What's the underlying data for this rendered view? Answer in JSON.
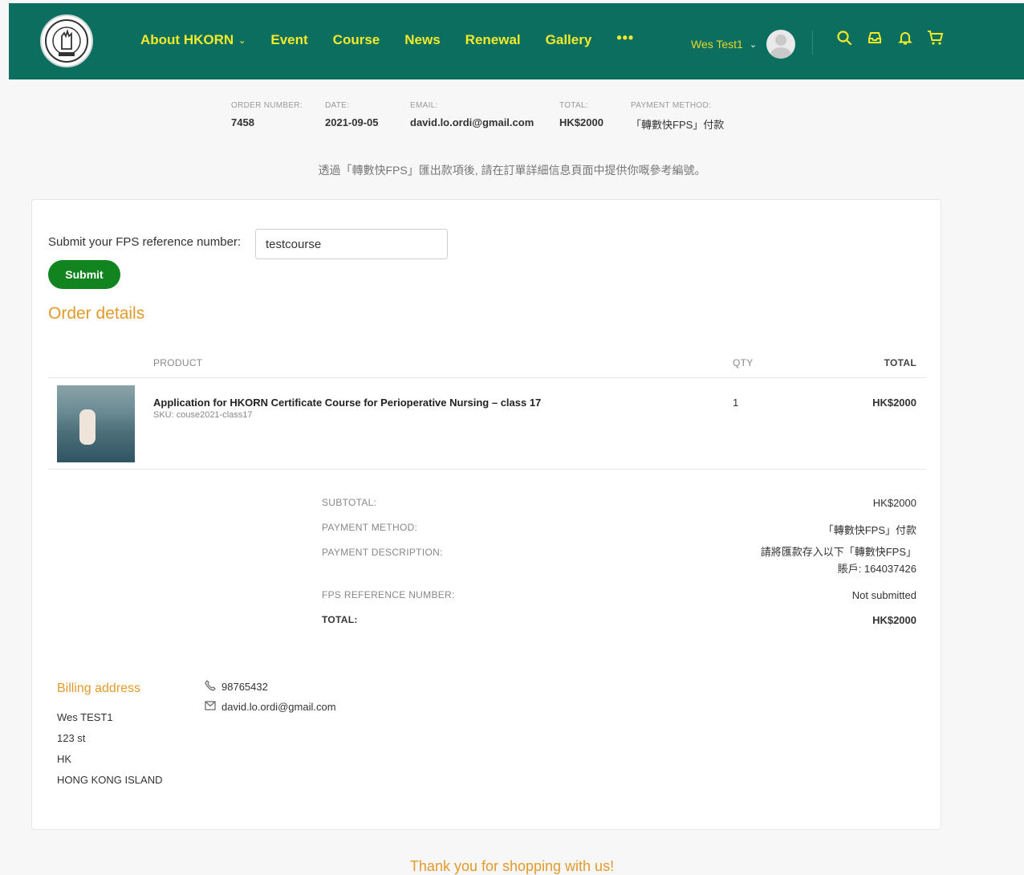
{
  "header": {
    "nav": [
      {
        "label": "About HKORN",
        "has_dropdown": true
      },
      {
        "label": "Event"
      },
      {
        "label": "Course"
      },
      {
        "label": "News"
      },
      {
        "label": "Renewal"
      },
      {
        "label": "Gallery"
      },
      {
        "label": "•••"
      }
    ],
    "user_name": "Wes Test1",
    "icons": [
      "search-icon",
      "inbox-icon",
      "bell-icon",
      "cart-icon"
    ],
    "colors": {
      "bar": "#0b6e5f",
      "nav_text": "#f3ea2a"
    }
  },
  "order_summary": {
    "order_number_label": "ORDER NUMBER:",
    "order_number": "7458",
    "date_label": "DATE:",
    "date": "2021-09-05",
    "email_label": "EMAIL:",
    "email": "david.lo.ordi@gmail.com",
    "total_label": "TOTAL:",
    "total": "HK$2000",
    "payment_label": "PAYMENT METHOD:",
    "payment": "「轉數快FPS」付款"
  },
  "fps_note": "透過「轉數快FPS」匯出款項後, 請在訂單詳細信息頁面中提供你嘅參考編號。",
  "reference_form": {
    "label": "Submit your FPS reference number:",
    "value": "testcourse",
    "submit_label": "Submit"
  },
  "order_details": {
    "title": "Order details",
    "headers": {
      "product": "PRODUCT",
      "qty": "QTY",
      "total": "TOTAL"
    },
    "items": [
      {
        "name": "Application for HKORN Certificate Course for Perioperative Nursing – class 17",
        "sku": "SKU: couse2021-class17",
        "qty": "1",
        "total": "HK$2000"
      }
    ],
    "totals": {
      "subtotal_label": "SUBTOTAL:",
      "subtotal": "HK$2000",
      "payment_method_label": "PAYMENT METHOD:",
      "payment_method": "「轉數快FPS」付款",
      "payment_description_label": "PAYMENT DESCRIPTION:",
      "payment_description": "請將匯款存入以下「轉數快FPS」賬戶: 164037426",
      "fps_ref_label": "FPS REFERENCE NUMBER:",
      "fps_ref": "Not submitted",
      "total_label": "TOTAL:",
      "total": "HK$2000"
    }
  },
  "billing": {
    "title": "Billing address",
    "lines": [
      "Wes TEST1",
      "123 st",
      "HK",
      "HONG KONG ISLAND"
    ],
    "phone": "98765432",
    "email": "david.lo.ordi@gmail.com"
  },
  "footer_message": "Thank you for shopping with us!"
}
